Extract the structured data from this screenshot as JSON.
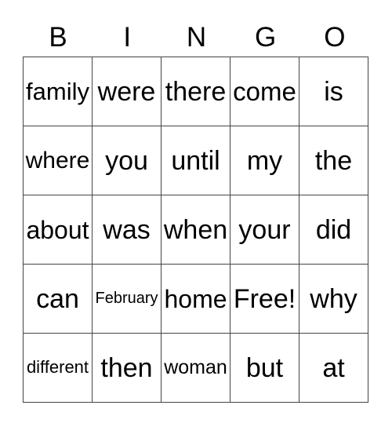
{
  "header": [
    "B",
    "I",
    "N",
    "G",
    "O"
  ],
  "rows": [
    [
      "family",
      "were",
      "there",
      "come",
      "is"
    ],
    [
      "where",
      "you",
      "until",
      "my",
      "the"
    ],
    [
      "about",
      "was",
      "when",
      "your",
      "did"
    ],
    [
      "can",
      "February",
      "home",
      "Free!",
      "why"
    ],
    [
      "different",
      "then",
      "woman",
      "but",
      "at"
    ]
  ]
}
